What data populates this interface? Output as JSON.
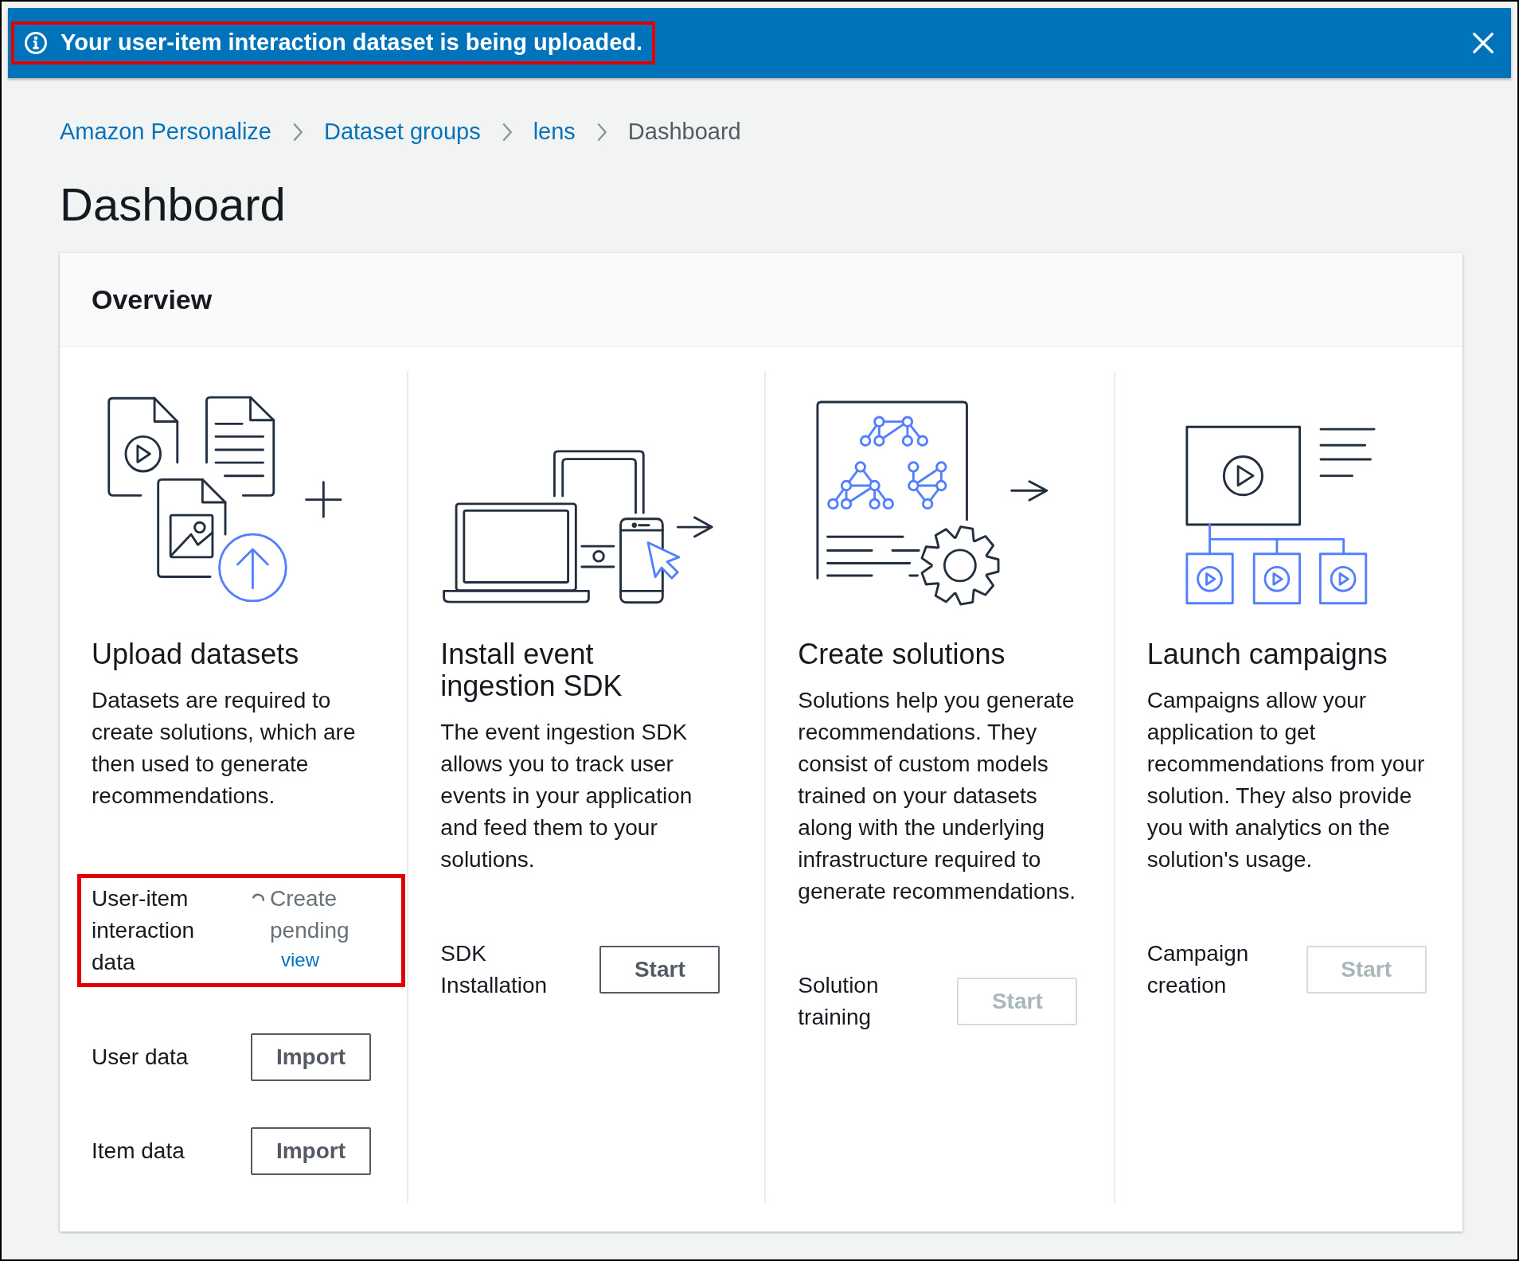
{
  "banner": {
    "message": "Your user-item interaction dataset is being uploaded.",
    "highlighted": true
  },
  "breadcrumbs": [
    {
      "label": "Amazon Personalize",
      "link": true
    },
    {
      "label": "Dataset groups",
      "link": true
    },
    {
      "label": "lens",
      "link": true
    },
    {
      "label": "Dashboard",
      "link": false
    }
  ],
  "page_title": "Dashboard",
  "overview": {
    "title": "Overview",
    "columns": [
      {
        "heading": "Upload datasets",
        "description": "Datasets are required to create solutions, which are then used to generate recommendations.",
        "actions": [
          {
            "kind": "status",
            "label": "User-item interaction data",
            "status": "Create pending",
            "link": "view",
            "highlighted": true
          },
          {
            "kind": "button",
            "label": "User data",
            "button": "Import",
            "disabled": false,
            "highlighted": false
          },
          {
            "kind": "button",
            "label": "Item data",
            "button": "Import",
            "disabled": false,
            "highlighted": false
          }
        ]
      },
      {
        "heading": "Install event ingestion SDK",
        "description": "The event ingestion SDK allows you to track user events in your application and feed them to your solutions.",
        "actions": [
          {
            "kind": "button",
            "label": "SDK Installation",
            "button": "Start",
            "disabled": false,
            "highlighted": false
          }
        ]
      },
      {
        "heading": "Create solutions",
        "description": "Solutions help you generate recommendations. They consist of custom models trained on your datasets along with the underlying infrastructure required to generate recommendations.",
        "actions": [
          {
            "kind": "button",
            "label": "Solution training",
            "button": "Start",
            "disabled": true,
            "highlighted": false
          }
        ]
      },
      {
        "heading": "Launch campaigns",
        "description": "Campaigns allow your application to get recommendations from your solution. They also provide you with analytics on the solution's usage.",
        "actions": [
          {
            "kind": "button",
            "label": "Campaign creation",
            "button": "Start",
            "disabled": true,
            "highlighted": false
          }
        ]
      }
    ]
  }
}
